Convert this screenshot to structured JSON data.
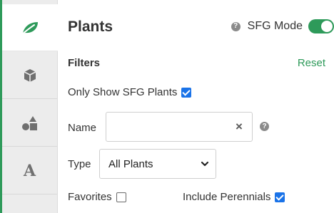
{
  "sidebar": {
    "tabs": [
      {
        "id": "plants",
        "icon": "leaf-icon",
        "active": true
      },
      {
        "id": "objects",
        "icon": "cube-icon",
        "active": false
      },
      {
        "id": "shapes",
        "icon": "shapes-icon",
        "active": false
      },
      {
        "id": "text",
        "icon": "letter-a-icon",
        "glyph": "A",
        "active": false
      }
    ]
  },
  "panel": {
    "title": "Plants",
    "help_glyph": "?",
    "sfg_mode_label": "SFG Mode",
    "sfg_mode_on": true
  },
  "filters": {
    "heading": "Filters",
    "reset_label": "Reset",
    "only_sfg_label": "Only Show SFG Plants",
    "only_sfg_checked": true,
    "name_label": "Name",
    "name_value": "",
    "name_placeholder": "",
    "clear_glyph": "×",
    "type_label": "Type",
    "type_selected": "All Plants",
    "favorites_label": "Favorites",
    "favorites_checked": false,
    "include_perennials_label": "Include Perennials",
    "include_perennials_checked": true
  },
  "colors": {
    "accent_green": "#2e9a5a",
    "checkbox_blue": "#1a73e8",
    "rail_bg": "#ececec"
  }
}
